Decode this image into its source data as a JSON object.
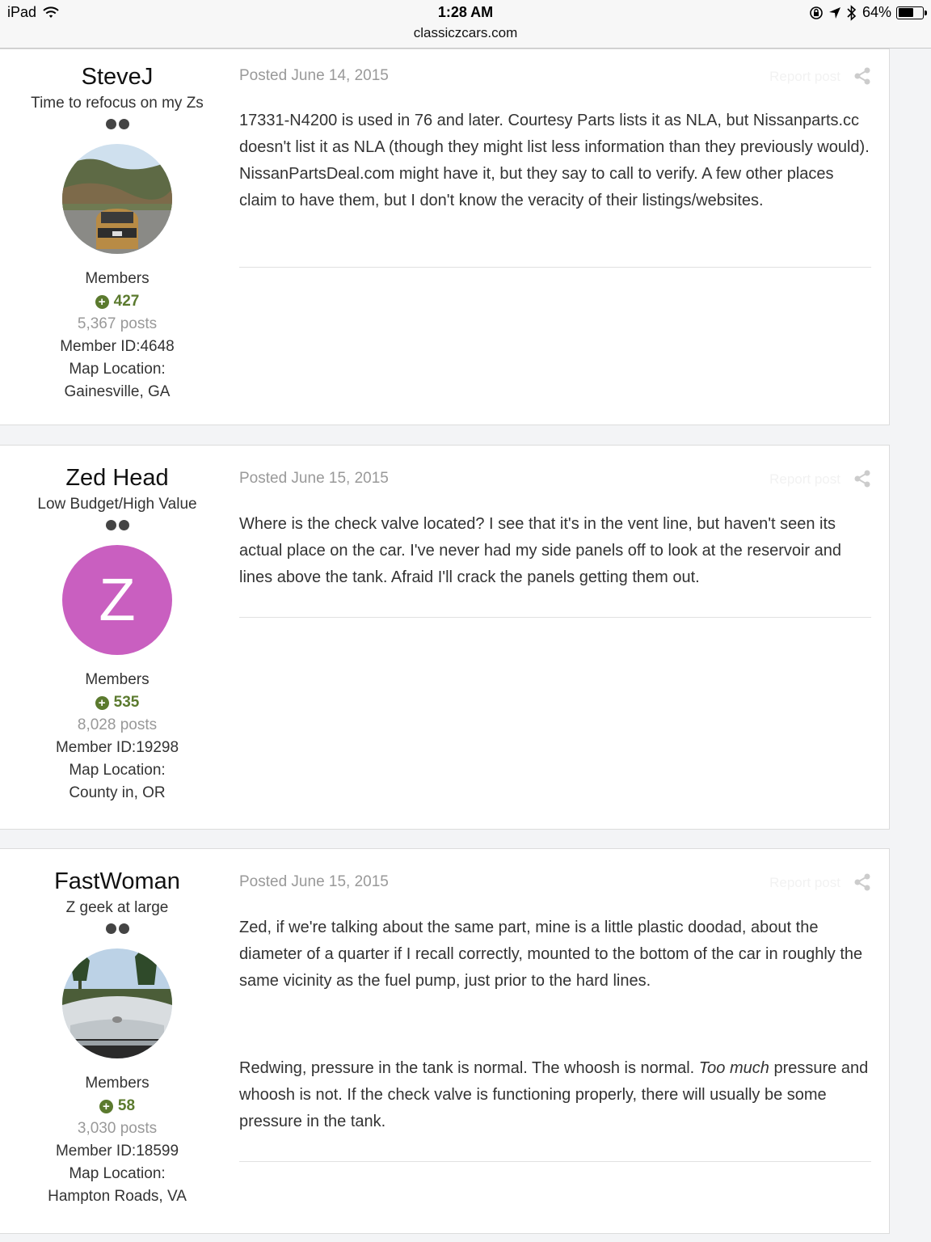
{
  "status_bar": {
    "device": "iPad",
    "time": "1:28 AM",
    "url": "classiczcars.com",
    "battery_percent": "64%",
    "battery_level": 0.64
  },
  "posts": [
    {
      "author": "SteveJ",
      "title": "Time to refocus on my Zs",
      "group": "Members",
      "reputation": "427",
      "posts": "5,367 posts",
      "member_id": "Member ID:4648",
      "map_label": "Map Location:",
      "location": "Gainesville, GA",
      "posted": "Posted June 14, 2015",
      "report": "Report post",
      "paragraphs": [
        "17331-N4200 is used in 76 and later. Courtesy Parts lists it as NLA, but Nissanparts.cc doesn't list it as NLA (though they might list less information than they previously would). NissanPartsDeal.com might have it, but they say to call to verify. A few other places claim to have them, but I don't know the veracity of their listings/websites."
      ]
    },
    {
      "author": "Zed Head",
      "title": "Low Budget/High Value",
      "avatar_letter": "Z",
      "group": "Members",
      "reputation": "535",
      "posts": "8,028 posts",
      "member_id": "Member ID:19298",
      "map_label": "Map Location:",
      "location": "County in, OR",
      "posted": "Posted June 15, 2015",
      "report": "Report post",
      "paragraphs": [
        "Where is the check valve located?  I see that it's in the vent line, but haven't seen its actual place on the car.  I've never had my side panels off to look at the reservoir and lines above the tank.  Afraid I'll crack the panels getting them out."
      ]
    },
    {
      "author": "FastWoman",
      "title": "Z geek at large",
      "group": "Members",
      "reputation": "58",
      "posts": "3,030 posts",
      "member_id": "Member ID:18599",
      "map_label": "Map Location:",
      "location": "Hampton Roads, VA",
      "posted": "Posted June 15, 2015",
      "report": "Report post",
      "paragraphs": [
        "Zed, if we're talking about the same part, mine is a little plastic doodad, about the diameter of a quarter if I recall correctly, mounted to the bottom of the car in roughly the same vicinity as the fuel pump, just prior to the hard lines.",
        "Redwing, pressure in the tank is normal.  The whoosh is normal.",
        "Too much",
        "pressure and whoosh is not.  If the check valve is functioning properly, there will usually be some pressure in the tank."
      ]
    }
  ]
}
